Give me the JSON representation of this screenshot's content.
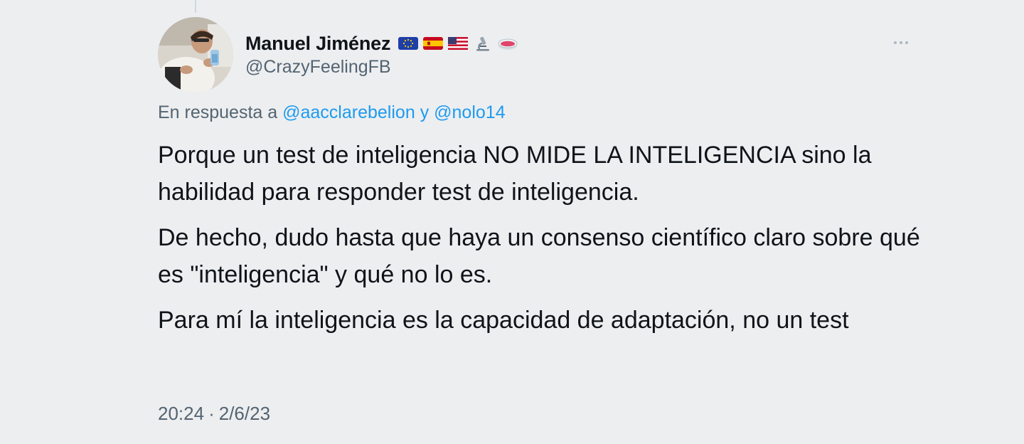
{
  "author": {
    "display_name": "Manuel Jiménez",
    "handle": "@CrazyFeelingFB",
    "emoji_icons": [
      "eu-flag-icon",
      "spain-flag-icon",
      "usa-flag-icon",
      "microscope-icon",
      "petri-dish-icon"
    ]
  },
  "reply": {
    "prefix": "En respuesta a",
    "mention_1": "@aacclarebelion",
    "conjunction": "y",
    "mention_2": "@nolo14"
  },
  "tweet": {
    "paragraphs": [
      "Porque un test de inteligencia NO MIDE LA INTELIGENCIA sino la habilidad para responder test de inteligencia.",
      "De hecho, dudo hasta que haya un consenso científico claro sobre qué es \"inteligencia\" y qué no lo es.",
      "Para mí la inteligencia es la capacidad de adaptación, no un test"
    ]
  },
  "meta": {
    "time": "20:24",
    "separator": "·",
    "date": "2/6/23"
  },
  "colors": {
    "background": "#edeef0",
    "text": "#0f1419",
    "secondary": "#536471",
    "link": "#1d9bf0"
  }
}
